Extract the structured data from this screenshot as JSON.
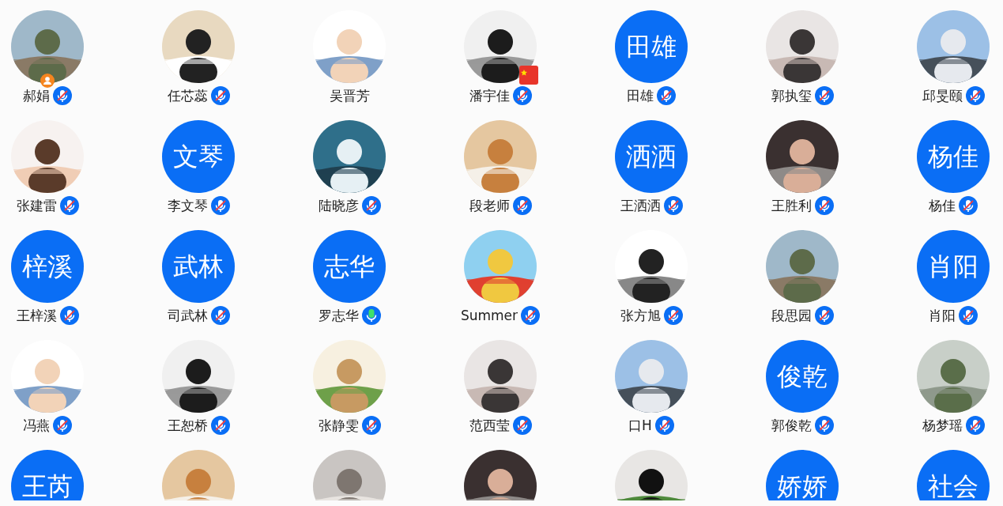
{
  "members": [
    {
      "name": "郝娟",
      "avatar": {
        "kind": "picture"
      },
      "mic": true,
      "muted": true,
      "host": true,
      "flag": false
    },
    {
      "name": "任芯蕊",
      "avatar": {
        "kind": "picture"
      },
      "mic": true,
      "muted": true,
      "host": false,
      "flag": false
    },
    {
      "name": "吴晋芳",
      "avatar": {
        "kind": "picture"
      },
      "mic": false,
      "muted": false,
      "host": false,
      "flag": false
    },
    {
      "name": "潘宇佳",
      "avatar": {
        "kind": "picture"
      },
      "mic": true,
      "muted": true,
      "host": false,
      "flag": true
    },
    {
      "name": "田雄",
      "avatar": {
        "kind": "text",
        "text": "田雄"
      },
      "mic": true,
      "muted": true,
      "host": false,
      "flag": false
    },
    {
      "name": "郭执玺",
      "avatar": {
        "kind": "picture"
      },
      "mic": true,
      "muted": true,
      "host": false,
      "flag": false
    },
    {
      "name": "邱旻颐",
      "avatar": {
        "kind": "picture"
      },
      "mic": true,
      "muted": true,
      "host": false,
      "flag": false
    },
    {
      "name": "张建雷",
      "avatar": {
        "kind": "picture"
      },
      "mic": true,
      "muted": true,
      "host": false,
      "flag": false
    },
    {
      "name": "李文琴",
      "avatar": {
        "kind": "text",
        "text": "文琴"
      },
      "mic": true,
      "muted": true,
      "host": false,
      "flag": false
    },
    {
      "name": "陆晓彦",
      "avatar": {
        "kind": "picture"
      },
      "mic": true,
      "muted": true,
      "host": false,
      "flag": false
    },
    {
      "name": "段老师",
      "avatar": {
        "kind": "picture"
      },
      "mic": true,
      "muted": true,
      "host": false,
      "flag": false
    },
    {
      "name": "王洒洒",
      "avatar": {
        "kind": "text",
        "text": "洒洒"
      },
      "mic": true,
      "muted": true,
      "host": false,
      "flag": false
    },
    {
      "name": "王胜利",
      "avatar": {
        "kind": "picture"
      },
      "mic": true,
      "muted": true,
      "host": false,
      "flag": false
    },
    {
      "name": "杨佳",
      "avatar": {
        "kind": "text",
        "text": "杨佳"
      },
      "mic": true,
      "muted": true,
      "host": false,
      "flag": false
    },
    {
      "name": "王梓溪",
      "avatar": {
        "kind": "text",
        "text": "梓溪"
      },
      "mic": true,
      "muted": true,
      "host": false,
      "flag": false
    },
    {
      "name": "司武林",
      "avatar": {
        "kind": "text",
        "text": "武林"
      },
      "mic": true,
      "muted": true,
      "host": false,
      "flag": false
    },
    {
      "name": "罗志华",
      "avatar": {
        "kind": "text",
        "text": "志华"
      },
      "mic": true,
      "muted": false,
      "host": false,
      "flag": false
    },
    {
      "name": "Summer",
      "avatar": {
        "kind": "picture"
      },
      "mic": true,
      "muted": true,
      "host": false,
      "flag": false
    },
    {
      "name": "张方旭",
      "avatar": {
        "kind": "picture"
      },
      "mic": true,
      "muted": true,
      "host": false,
      "flag": false
    },
    {
      "name": "段思园",
      "avatar": {
        "kind": "picture"
      },
      "mic": true,
      "muted": true,
      "host": false,
      "flag": false
    },
    {
      "name": "肖阳",
      "avatar": {
        "kind": "text",
        "text": "肖阳"
      },
      "mic": true,
      "muted": true,
      "host": false,
      "flag": false
    },
    {
      "name": "冯燕",
      "avatar": {
        "kind": "picture"
      },
      "mic": true,
      "muted": true,
      "host": false,
      "flag": false
    },
    {
      "name": "王恕桥",
      "avatar": {
        "kind": "picture"
      },
      "mic": true,
      "muted": true,
      "host": false,
      "flag": false
    },
    {
      "name": "张静雯",
      "avatar": {
        "kind": "picture"
      },
      "mic": true,
      "muted": true,
      "host": false,
      "flag": false
    },
    {
      "name": "范西莹",
      "avatar": {
        "kind": "picture"
      },
      "mic": true,
      "muted": true,
      "host": false,
      "flag": false
    },
    {
      "name": "口H",
      "avatar": {
        "kind": "picture"
      },
      "mic": true,
      "muted": true,
      "host": false,
      "flag": false
    },
    {
      "name": "郭俊乾",
      "avatar": {
        "kind": "text",
        "text": "俊乾"
      },
      "mic": true,
      "muted": true,
      "host": false,
      "flag": false
    },
    {
      "name": "杨梦瑶",
      "avatar": {
        "kind": "picture"
      },
      "mic": true,
      "muted": true,
      "host": false,
      "flag": false
    }
  ],
  "partial_row": [
    {
      "avatar": {
        "kind": "text",
        "text": "王芮"
      }
    },
    {
      "avatar": {
        "kind": "picture"
      }
    },
    {
      "avatar": {
        "kind": "picture"
      }
    },
    {
      "avatar": {
        "kind": "picture"
      }
    },
    {
      "avatar": {
        "kind": "picture"
      }
    },
    {
      "avatar": {
        "kind": "text",
        "text": "娇娇"
      }
    },
    {
      "avatar": {
        "kind": "text",
        "text": "社会"
      }
    }
  ]
}
